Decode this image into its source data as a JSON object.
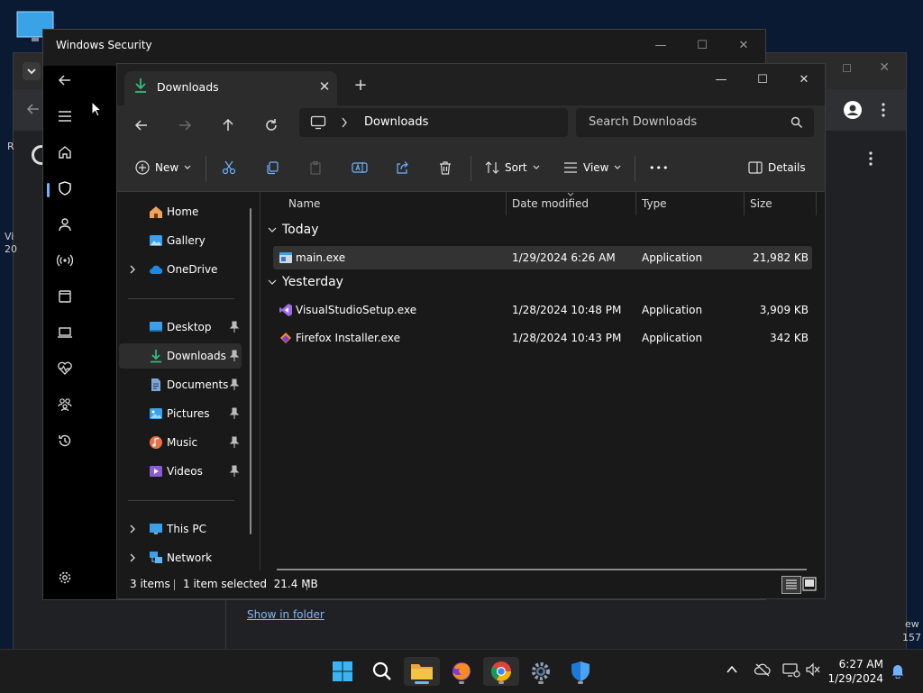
{
  "background_window": {
    "link_text": "Show in folder",
    "fragments": {
      "left_1": "R",
      "left_2": "Vi",
      "left_3": "20",
      "right_1": "ew",
      "right_2": "157"
    }
  },
  "windows_security": {
    "title": "Windows Security",
    "caption": {
      "minimize": "—",
      "maximize": "☐",
      "close": "✕"
    }
  },
  "explorer": {
    "tab_label": "Downloads",
    "tab_close": "✕",
    "new_tab": "+",
    "caption": {
      "minimize": "—",
      "maximize": "☐",
      "close": "✕"
    },
    "address": "Downloads",
    "search_placeholder": "Search Downloads",
    "commands": {
      "new": "New",
      "sort": "Sort",
      "view": "View",
      "more": "•••",
      "details": "Details"
    },
    "nav": {
      "home": "Home",
      "gallery": "Gallery",
      "onedrive": "OneDrive",
      "desktop": "Desktop",
      "downloads": "Downloads",
      "documents": "Documents",
      "pictures": "Pictures",
      "music": "Music",
      "videos": "Videos",
      "thispc": "This PC",
      "network": "Network"
    },
    "columns": {
      "name": "Name",
      "date": "Date modified",
      "type": "Type",
      "size": "Size"
    },
    "groups": {
      "today": {
        "label": "Today",
        "files": [
          {
            "name": "main.exe",
            "date": "1/29/2024 6:26 AM",
            "type": "Application",
            "size": "21,982 KB"
          }
        ]
      },
      "yesterday": {
        "label": "Yesterday",
        "files": [
          {
            "name": "VisualStudioSetup.exe",
            "date": "1/28/2024 10:48 PM",
            "type": "Application",
            "size": "3,909 KB"
          },
          {
            "name": "Firefox Installer.exe",
            "date": "1/28/2024 10:43 PM",
            "type": "Application",
            "size": "342 KB"
          }
        ]
      }
    },
    "status": {
      "count": "3 items",
      "selection": "1 item selected  21.4 MB"
    }
  },
  "taskbar": {
    "time": "6:27 AM",
    "date": "1/29/2024"
  },
  "colors": {
    "accent": "#6fb2ff",
    "folder": "#f5c342",
    "download_arrow": "#2ec27e"
  }
}
